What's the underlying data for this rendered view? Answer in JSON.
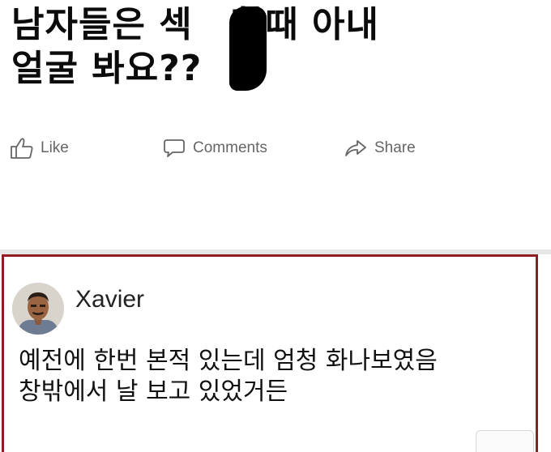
{
  "post": {
    "title_line1": "남자들은 섹",
    "title_line1_end": "할때 아내",
    "title_line2": "얼굴 봐요??"
  },
  "actions": {
    "like": "Like",
    "comments": "Comments",
    "share": "Share"
  },
  "comment": {
    "author": "Xavier",
    "text_line1": "예전에 한번 본적 있는데 엄청 화나보였음",
    "text_line2": "창밖에서 날 보고 있었거든"
  }
}
